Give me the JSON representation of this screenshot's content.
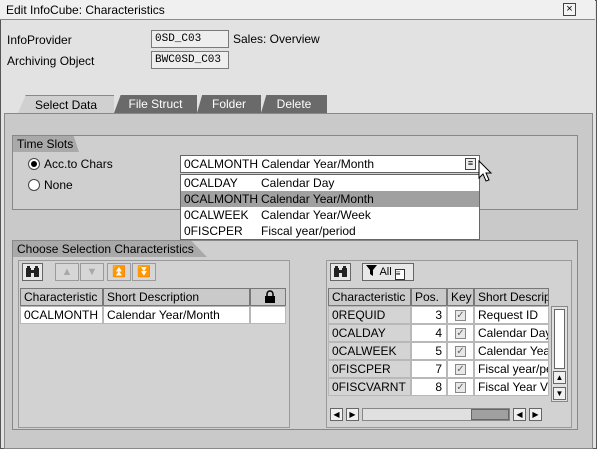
{
  "window": {
    "title": "Edit InfoCube: Characteristics",
    "close_label": "×"
  },
  "header": {
    "infoprovider_label": "InfoProvider",
    "infoprovider_value": "0SD_C03",
    "infoprovider_desc": "Sales: Overview",
    "archiving_label": "Archiving Object",
    "archiving_value": "BWC0SD_C03"
  },
  "tabs": [
    {
      "label": "Select Data",
      "active": true
    },
    {
      "label": "File Struct",
      "active": false
    },
    {
      "label": "Folder",
      "active": false
    },
    {
      "label": "Delete",
      "active": false
    }
  ],
  "time_slots": {
    "title": "Time Slots",
    "option_chars": "Acc.to Chars",
    "option_none": "None",
    "selected_value": "0CALMONTH Calendar Year/Month",
    "options": [
      {
        "key": "0CALDAY",
        "desc": "Calendar Day"
      },
      {
        "key": "0CALMONTH",
        "desc": "Calendar Year/Month"
      },
      {
        "key": "0CALWEEK",
        "desc": "Calendar Year/Week"
      },
      {
        "key": "0FISCPER",
        "desc": "Fiscal year/period"
      }
    ],
    "highlighted_index": 1
  },
  "selection": {
    "title": "Choose Selection Characteristics",
    "left_table": {
      "headers": [
        "Characteristic",
        "Short Description"
      ],
      "rows": [
        {
          "char": "0CALMONTH",
          "desc": "Calendar Year/Month"
        }
      ]
    },
    "filter_label": "All",
    "right_table": {
      "headers": [
        "Characteristic",
        "Pos.",
        "Key",
        "Short Descrip"
      ],
      "rows": [
        {
          "char": "0REQUID",
          "pos": "3",
          "desc": "Request ID"
        },
        {
          "char": "0CALDAY",
          "pos": "4",
          "desc": "Calendar Day"
        },
        {
          "char": "0CALWEEK",
          "pos": "5",
          "desc": "Calendar Yea"
        },
        {
          "char": "0FISCPER",
          "pos": "7",
          "desc": "Fiscal year/pe"
        },
        {
          "char": "0FISCVARNT",
          "pos": "8",
          "desc": "Fiscal Year V"
        }
      ]
    }
  }
}
